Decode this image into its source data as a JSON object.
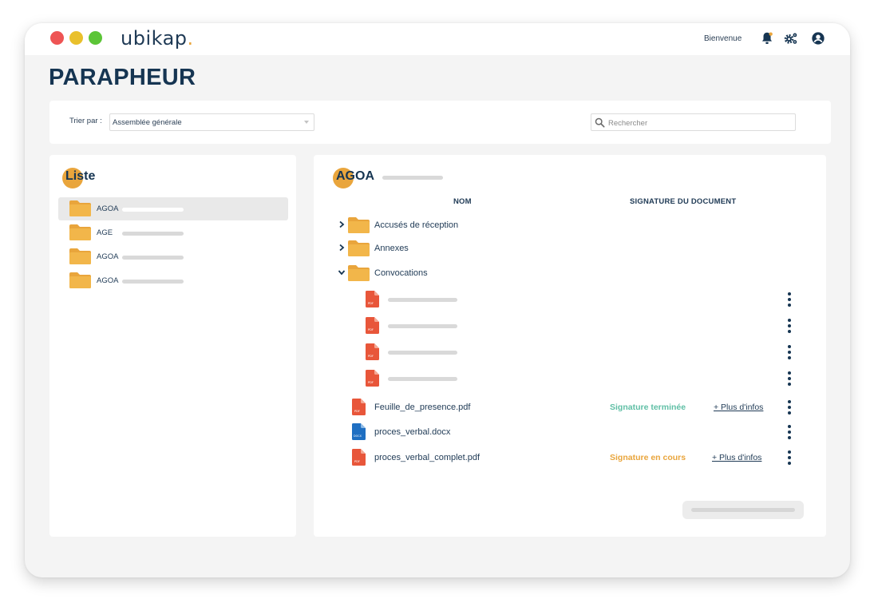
{
  "app": {
    "logo": "ubikap",
    "logo_dot": "."
  },
  "header": {
    "welcome": "Bienvenue",
    "icons": [
      "bell-icon",
      "settings-gears-icon",
      "user-account-icon"
    ]
  },
  "page": {
    "title": "PARAPHEUR"
  },
  "filter": {
    "sort_label": "Trier par :",
    "sort_value": "Assemblée générale",
    "search_placeholder": "Rechercher"
  },
  "list": {
    "heading": "Liste",
    "items": [
      {
        "label": "AGOA",
        "selected": true
      },
      {
        "label": "AGE",
        "selected": false
      },
      {
        "label": "AGOA",
        "selected": false
      },
      {
        "label": "AGOA",
        "selected": false
      }
    ]
  },
  "detail": {
    "heading": "AGOA",
    "columns": {
      "name": "NOM",
      "signature": "SIGNATURE DU DOCUMENT"
    },
    "folders": [
      {
        "name": "Accusés de réception",
        "expanded": false
      },
      {
        "name": "Annexes",
        "expanded": false
      },
      {
        "name": "Convocations",
        "expanded": true
      }
    ],
    "sub_files": [
      {
        "type": "PDF"
      },
      {
        "type": "PDF"
      },
      {
        "type": "PDF"
      },
      {
        "type": "PDF"
      }
    ],
    "files": [
      {
        "name": "Feuille_de_presence.pdf",
        "type": "PDF",
        "status": "Signature terminée",
        "more": "+ Plus d'infos"
      },
      {
        "name": "proces_verbal.docx",
        "type": "DOCX",
        "status": "",
        "more": ""
      },
      {
        "name": "proces_verbal_complet.pdf",
        "type": "PDF",
        "status": "Signature en cours",
        "more": "+ Plus d'infos"
      }
    ]
  },
  "colors": {
    "accent": "#e9a53c",
    "navy": "#163552",
    "pdf": "#e8563a",
    "docx": "#1f6fc2",
    "done": "#5fbfa5",
    "in_progress": "#e9a53c"
  }
}
